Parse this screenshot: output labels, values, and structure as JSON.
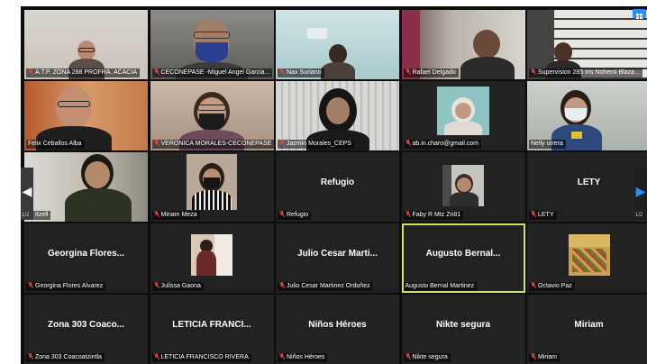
{
  "meeting": {
    "page_left": "1/2",
    "page_right": "1/2"
  },
  "colors": {
    "background": "#0d0d0d",
    "tile": "#222222",
    "active_speaker_border": "#d6e15a",
    "mute_icon": "#e0463d",
    "accent_blue": "#2d8cff"
  },
  "participants": [
    {
      "label": "A.T.P. ZONA 288 PROFRA. ACACIA",
      "muted": true,
      "video": true
    },
    {
      "label": "CECONEPASE -Miguel Angel Garcia...",
      "muted": true,
      "video": true
    },
    {
      "label": "Nax Suriano",
      "muted": true,
      "video": true
    },
    {
      "label": "Rafael Delgado",
      "muted": true,
      "video": true
    },
    {
      "label": "Supervision 285 Iris Nohemi Blaza...",
      "muted": true,
      "video": true
    },
    {
      "label": "Felix Ceballos Alba",
      "muted": false,
      "video": true
    },
    {
      "label": "VERONICA MORALES-CECONEPASE",
      "muted": true,
      "video": true
    },
    {
      "label": "Jazmin Morales_CEPS",
      "muted": true,
      "video": true
    },
    {
      "label": "ab.in.charo@gmail.com",
      "muted": true,
      "video": true
    },
    {
      "label": "Nelly utrera",
      "muted": false,
      "video": true
    },
    {
      "label": "Itzell",
      "muted": true,
      "video": true
    },
    {
      "label": "Miriam Meza",
      "muted": true,
      "video": true
    },
    {
      "label": "Refugio",
      "display": "Refugio",
      "muted": true,
      "video": false
    },
    {
      "label": "Faby R Mtz Zn81",
      "muted": true,
      "video": true
    },
    {
      "label": "LETY",
      "display": "LETY",
      "muted": true,
      "video": false
    },
    {
      "label": "Georgina Flores Alvarez",
      "display": "Georgina Flores...",
      "muted": true,
      "video": false
    },
    {
      "label": "Julissa Gaona",
      "muted": true,
      "video": true
    },
    {
      "label": "Julio Cesar Martinez Ordoñez",
      "display": "Julio Cesar Marti...",
      "muted": true,
      "video": false
    },
    {
      "label": "Augusto Bernal Martinez",
      "display": "Augusto Bernal...",
      "muted": false,
      "video": false,
      "active": true
    },
    {
      "label": "Octavio Paz",
      "muted": true,
      "video": true
    },
    {
      "label": "Zona 303 Coacoatzintla",
      "display": "Zona 303 Coaco...",
      "muted": true,
      "video": false
    },
    {
      "label": "LETICIA FRANCISCO RIVERA",
      "display": "LETICIA FRANCI...",
      "muted": true,
      "video": false
    },
    {
      "label": "Niños Héroes",
      "display": "Niños Héroes",
      "muted": true,
      "video": false
    },
    {
      "label": "Nikte segura",
      "display": "Nikte segura",
      "muted": true,
      "video": false
    },
    {
      "label": "Miriam",
      "display": "Miriam",
      "muted": true,
      "video": false
    }
  ]
}
